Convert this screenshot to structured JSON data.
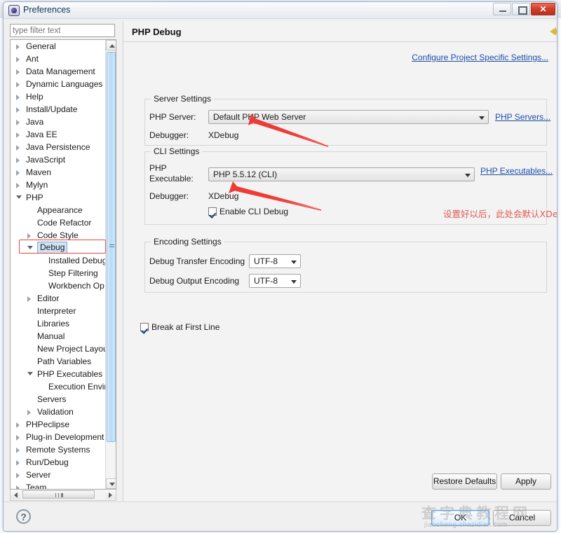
{
  "window": {
    "title": "Preferences",
    "icon": "preferences-icon",
    "controls": {
      "minimize": "minimize-button",
      "maximize": "maximize-button",
      "close_label": "✕"
    }
  },
  "sidebar": {
    "filter": {
      "placeholder": "type filter text",
      "value": ""
    },
    "tree": [
      {
        "label": "General",
        "indent": 0,
        "state": "collapsed"
      },
      {
        "label": "Ant",
        "indent": 0,
        "state": "collapsed"
      },
      {
        "label": "Data Management",
        "indent": 0,
        "state": "collapsed"
      },
      {
        "label": "Dynamic Languages",
        "indent": 0,
        "state": "collapsed"
      },
      {
        "label": "Help",
        "indent": 0,
        "state": "collapsed"
      },
      {
        "label": "Install/Update",
        "indent": 0,
        "state": "collapsed"
      },
      {
        "label": "Java",
        "indent": 0,
        "state": "collapsed"
      },
      {
        "label": "Java EE",
        "indent": 0,
        "state": "collapsed"
      },
      {
        "label": "Java Persistence",
        "indent": 0,
        "state": "collapsed"
      },
      {
        "label": "JavaScript",
        "indent": 0,
        "state": "collapsed"
      },
      {
        "label": "Maven",
        "indent": 0,
        "state": "collapsed"
      },
      {
        "label": "Mylyn",
        "indent": 0,
        "state": "collapsed"
      },
      {
        "label": "PHP",
        "indent": 0,
        "state": "expanded"
      },
      {
        "label": "Appearance",
        "indent": 1,
        "state": "leaf"
      },
      {
        "label": "Code Refactor",
        "indent": 1,
        "state": "leaf"
      },
      {
        "label": "Code Style",
        "indent": 1,
        "state": "collapsed"
      },
      {
        "label": "Debug",
        "indent": 1,
        "state": "expanded",
        "selected": true
      },
      {
        "label": "Installed Debug",
        "indent": 2,
        "state": "leaf",
        "clipped": true
      },
      {
        "label": "Step Filtering",
        "indent": 2,
        "state": "leaf"
      },
      {
        "label": "Workbench Op",
        "indent": 2,
        "state": "leaf",
        "clipped": true
      },
      {
        "label": "Editor",
        "indent": 1,
        "state": "collapsed"
      },
      {
        "label": "Interpreter",
        "indent": 1,
        "state": "leaf"
      },
      {
        "label": "Libraries",
        "indent": 1,
        "state": "leaf"
      },
      {
        "label": "Manual",
        "indent": 1,
        "state": "leaf"
      },
      {
        "label": "New Project Layou",
        "indent": 1,
        "state": "leaf",
        "clipped": true
      },
      {
        "label": "Path Variables",
        "indent": 1,
        "state": "leaf"
      },
      {
        "label": "PHP Executables",
        "indent": 1,
        "state": "expanded"
      },
      {
        "label": "Execution Envir",
        "indent": 2,
        "state": "leaf",
        "clipped": true
      },
      {
        "label": "Servers",
        "indent": 1,
        "state": "leaf"
      },
      {
        "label": "Validation",
        "indent": 1,
        "state": "collapsed"
      },
      {
        "label": "PHPeclipse",
        "indent": 0,
        "state": "collapsed"
      },
      {
        "label": "Plug-in Development",
        "indent": 0,
        "state": "collapsed"
      },
      {
        "label": "Remote Systems",
        "indent": 0,
        "state": "collapsed"
      },
      {
        "label": "Run/Debug",
        "indent": 0,
        "state": "collapsed"
      },
      {
        "label": "Server",
        "indent": 0,
        "state": "collapsed"
      },
      {
        "label": "Team",
        "indent": 0,
        "state": "collapsed"
      }
    ]
  },
  "content": {
    "title": "PHP Debug",
    "configure_link": "Configure Project Specific Settings...",
    "nav": {
      "back_icon": "back-arrow-icon",
      "back_menu_icon": "chevron-down-icon",
      "forward_icon": "forward-arrow-icon",
      "forward_menu_icon": "chevron-down-icon",
      "more_menu_icon": "chevron-down-icon"
    },
    "server_settings": {
      "legend": "Server Settings",
      "php_server_label": "PHP Server:",
      "php_server_value": "Default PHP Web Server",
      "php_servers_link": "PHP Servers...",
      "debugger_label": "Debugger:",
      "debugger_value": "XDebug"
    },
    "cli_settings": {
      "legend": "CLI Settings",
      "php_executable_label_line1": "PHP",
      "php_executable_label_line2": "Executable:",
      "php_executable_value": "PHP 5.5.12 (CLI)",
      "php_executables_link": "PHP Executables...",
      "debugger_label": "Debugger:",
      "debugger_value": "XDebug",
      "enable_cli_debug_label": "Enable CLI Debug",
      "enable_cli_debug_checked": true
    },
    "encoding_settings": {
      "legend": "Encoding Settings",
      "transfer_label": "Debug Transfer Encoding",
      "transfer_value": "UTF-8",
      "output_label": "Debug Output Encoding",
      "output_value": "UTF-8"
    },
    "break_at_first_line": {
      "label": "Break at First Line",
      "checked": true
    },
    "annotations": {
      "note_text": "设置好以后，此处会默认XDebug",
      "color": "#e05a52"
    },
    "buttons": {
      "restore_defaults": "Restore Defaults",
      "apply": "Apply"
    }
  },
  "footer": {
    "help_icon": "help-icon",
    "help_glyph": "?",
    "ok": "OK",
    "cancel": "Cancel"
  },
  "watermark": {
    "cn": "查字典教程网",
    "url": "jiaocheng.chazidian.com"
  },
  "colors": {
    "accent": "#1c4ea8",
    "annotation_red": "#e8473f",
    "selection_blue": "#cfe3f7",
    "close_red": "#d33f28"
  }
}
